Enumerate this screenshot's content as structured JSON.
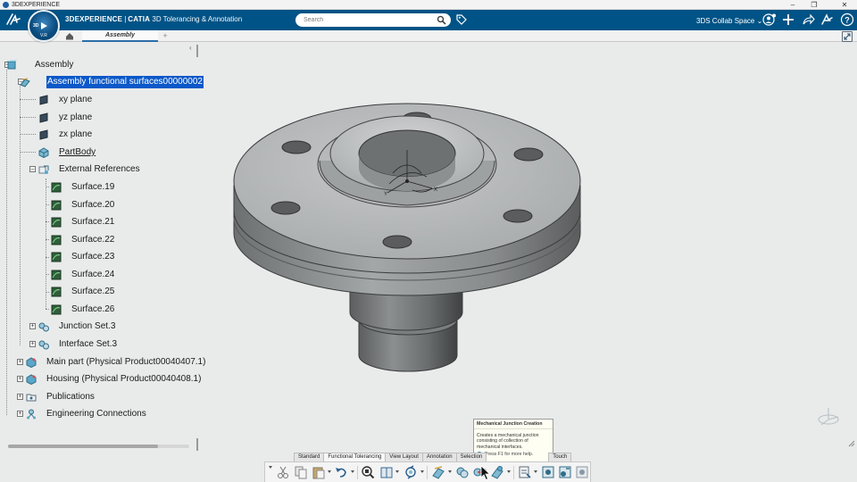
{
  "window": {
    "title": "3DEXPERIENCE"
  },
  "header": {
    "brand": "3DEXPERIENCE",
    "brand_sep": "|",
    "brand_product": "CATIA",
    "brand_app": "3D Tolerancing & Annotation",
    "compass_label": "3D",
    "compass_version": "V.R",
    "search_placeholder": "Search",
    "collab_space": "3DS Collab Space"
  },
  "tabs": {
    "active_label": "Assembly",
    "add_label": "+"
  },
  "tree": {
    "root": "Assembly",
    "selected": "Assembly functional surfaces00000002",
    "children": [
      {
        "label": "xy plane"
      },
      {
        "label": "yz plane"
      },
      {
        "label": "zx plane"
      },
      {
        "label": "PartBody"
      },
      {
        "label": "External References"
      }
    ],
    "surfaces": [
      "Surface.19",
      "Surface.20",
      "Surface.21",
      "Surface.22",
      "Surface.23",
      "Surface.24",
      "Surface.25",
      "Surface.26"
    ],
    "sets": [
      "Junction Set.3",
      "Interface Set.3"
    ],
    "top_level": [
      "Main part (Physical Product00040407.1)",
      "Housing (Physical Product00040408.1)",
      "Publications",
      "Engineering Connections"
    ]
  },
  "action_tabs": [
    "Standard",
    "Functional Tolerancing",
    "View Layout",
    "Annotation",
    "Selection",
    "Touch"
  ],
  "tooltip": {
    "title": "Mechanical Junction Creation",
    "body_lines": [
      "Creates a mechanical junction",
      "consisting of collection of",
      "mechanical interfaces."
    ],
    "help": "Press F1 for more help."
  },
  "colors": {
    "topbar": "#005386",
    "selection": "#0a58c9",
    "background": "#e9ebeb"
  }
}
